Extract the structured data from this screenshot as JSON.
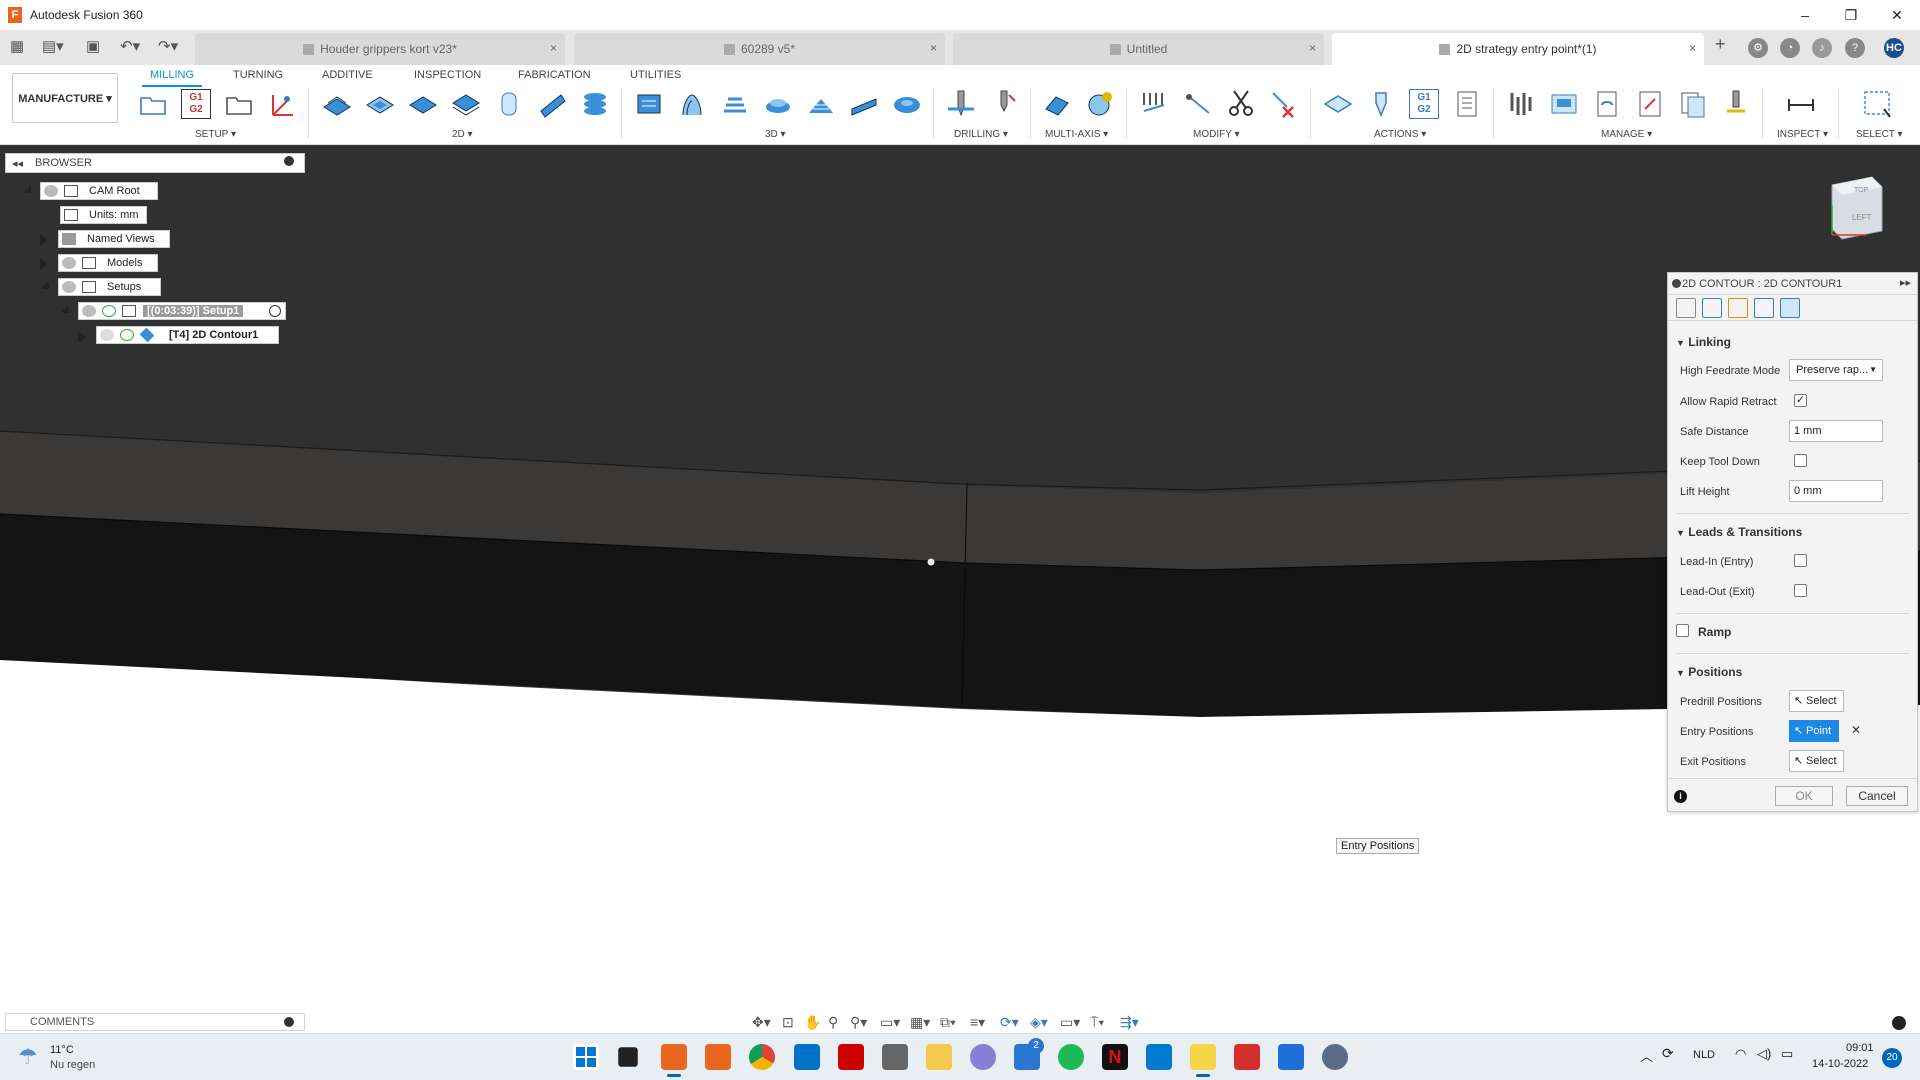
{
  "app": {
    "title": "Autodesk Fusion 360"
  },
  "window_controls": {
    "minimize": "–",
    "maximize": "❐",
    "close": "✕"
  },
  "tabs": [
    {
      "label": "Houder grippers kort v23*",
      "active": false
    },
    {
      "label": "60289 v5*",
      "active": false
    },
    {
      "label": "Untitled",
      "active": false
    },
    {
      "label": "2D strategy entry point*(1)",
      "active": true
    }
  ],
  "tab_close": "×",
  "user_initials": "HC",
  "ribbon": {
    "workspace": "MANUFACTURE ▾",
    "tabs": [
      "MILLING",
      "TURNING",
      "ADDITIVE",
      "INSPECTION",
      "FABRICATION",
      "UTILITIES"
    ],
    "groups": {
      "setup": "SETUP ▾",
      "twod": "2D ▾",
      "threed": "3D ▾",
      "drilling": "DRILLING ▾",
      "multiaxis": "MULTI-AXIS ▾",
      "modify": "MODIFY ▾",
      "actions": "ACTIONS ▾",
      "manage": "MANAGE ▾",
      "inspect": "INSPECT ▾",
      "select": "SELECT ▾"
    },
    "g1g2": "G1\nG2"
  },
  "browser": {
    "title": "BROWSER",
    "nodes": {
      "cam_root": "CAM Root",
      "units": "Units: mm",
      "named_views": "Named Views",
      "models": "Models",
      "setups": "Setups",
      "setup1": "[(0:03:39)] Setup1",
      "contour": "[T4] 2D Contour1"
    }
  },
  "viewcube": {
    "face": "LEFT",
    "top": "TOP"
  },
  "panel": {
    "title": "2D CONTOUR : 2D CONTOUR1",
    "sections": {
      "linking": "Linking",
      "leads": "Leads & Transitions",
      "ramp": "Ramp",
      "positions": "Positions"
    },
    "fields": {
      "high_feedrate_mode": {
        "label": "High Feedrate Mode",
        "value": "Preserve rap..."
      },
      "allow_rapid_retract": {
        "label": "Allow Rapid Retract",
        "checked": true
      },
      "safe_distance": {
        "label": "Safe Distance",
        "value": "1 mm"
      },
      "keep_tool_down": {
        "label": "Keep Tool Down",
        "checked": false
      },
      "lift_height": {
        "label": "Lift Height",
        "value": "0 mm"
      },
      "lead_in": {
        "label": "Lead-In (Entry)",
        "checked": false
      },
      "lead_out": {
        "label": "Lead-Out (Exit)",
        "checked": false
      },
      "predrill_positions": {
        "label": "Predrill Positions",
        "button": "Select"
      },
      "entry_positions": {
        "label": "Entry Positions",
        "button": "Point"
      },
      "exit_positions": {
        "label": "Exit Positions",
        "button": "Select"
      }
    },
    "ok": "OK",
    "cancel": "Cancel",
    "info": "i",
    "clear": "✕"
  },
  "tooltip": "Entry Positions",
  "comments": {
    "title": "COMMENTS"
  },
  "taskbar": {
    "weather_temp": "11°C",
    "weather_desc": "Nu regen",
    "language": "NLD",
    "time": "09:01",
    "date": "14-10-2022",
    "notifications": "20",
    "badge_2": "2",
    "netflix": "N"
  }
}
